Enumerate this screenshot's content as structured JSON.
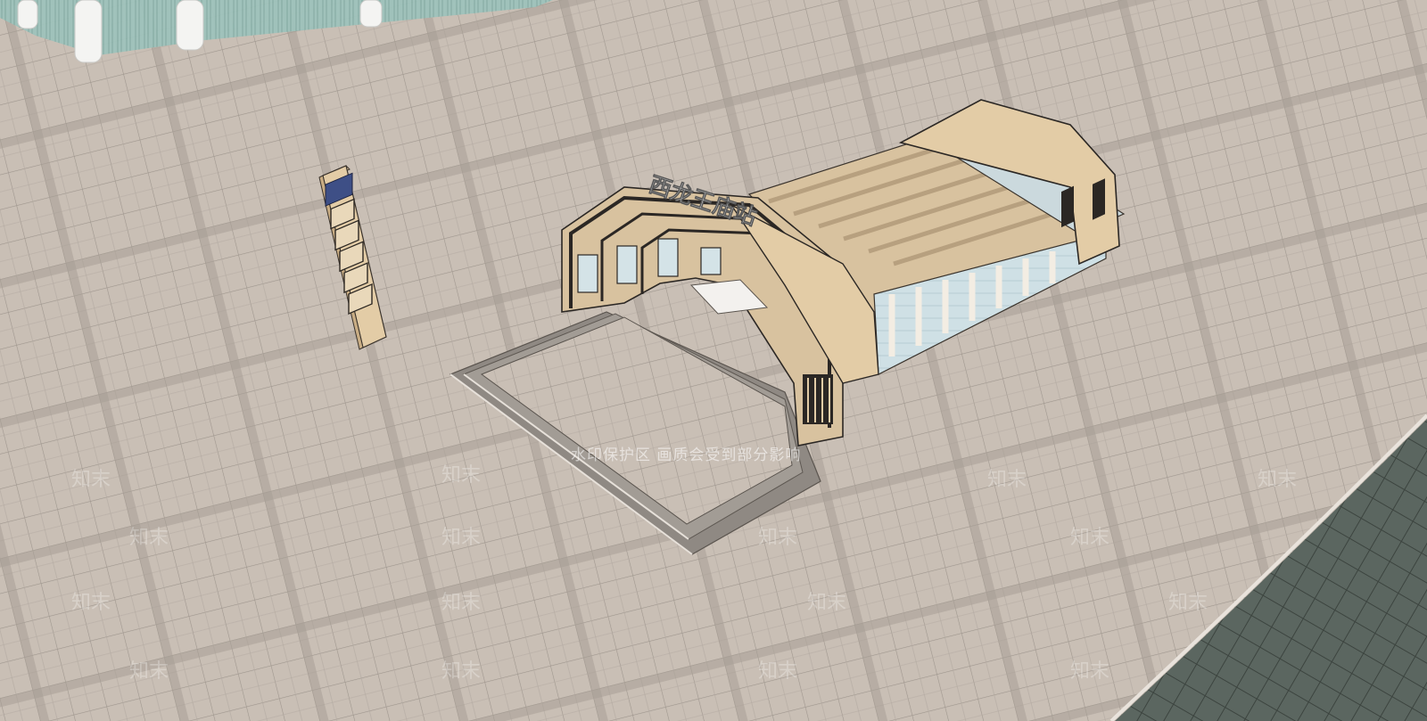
{
  "scene": {
    "station_sign": "西龙王庙站",
    "watermark": "水印保护区 画质会受到部分影响",
    "watermark_logo": "知末"
  },
  "colors": {
    "plaza": "#c9bfb5",
    "tile_line": "#9d948c",
    "band": "#a99f96",
    "stone": "#e2caa3",
    "stone_dark": "#c9ad84",
    "frame": "#2b2724",
    "glass": "#c9dde3",
    "grass": "#55605a"
  }
}
